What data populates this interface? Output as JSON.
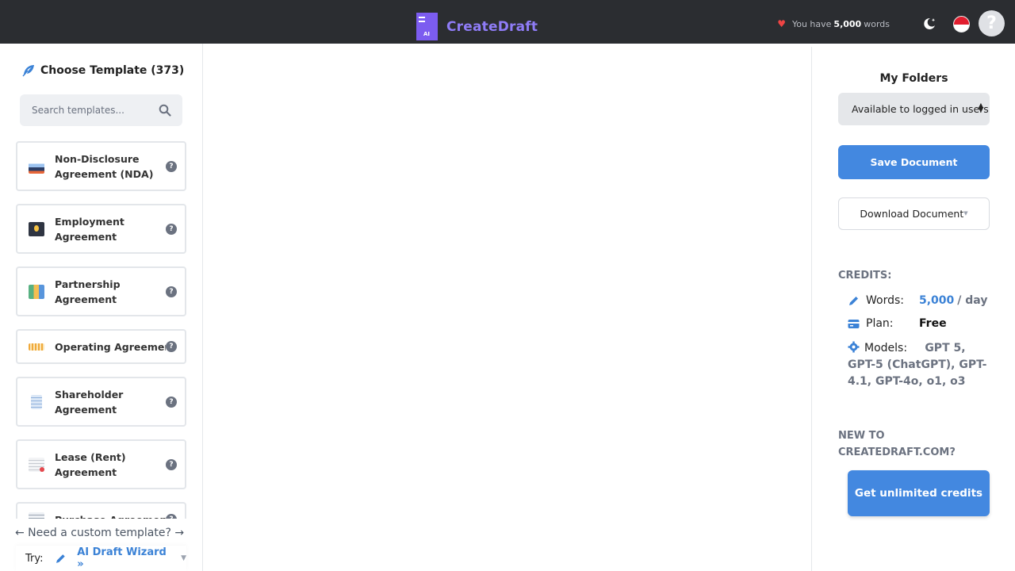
{
  "header": {
    "brand": "CreateDraft",
    "logo_badge": "AI",
    "words_prefix": "You have",
    "words_count": "5,000",
    "words_suffix": "words",
    "theme_toggle_icon": "moon-icon",
    "flag_icon": "singapore-flag-icon",
    "help_avatar": "?"
  },
  "sidebar": {
    "title": "Choose Template (373)",
    "search_placeholder": "Search templates...",
    "templates": [
      {
        "label": "Non-Disclosure Agreement (NDA)",
        "icon": "nda-icon"
      },
      {
        "label": "Employment Agreement",
        "icon": "employment-icon"
      },
      {
        "label": "Partnership Agreement",
        "icon": "partnership-icon"
      },
      {
        "label": "Operating Agreement",
        "icon": "operating-icon"
      },
      {
        "label": "Shareholder Agreement",
        "icon": "shareholder-icon"
      },
      {
        "label": "Lease (Rent) Agreement",
        "icon": "lease-icon"
      },
      {
        "label": "Purchase Agreement",
        "icon": "purchase-icon"
      }
    ],
    "help_glyph": "?",
    "custom_template": "← Need a custom template? →",
    "try_label": "Try:",
    "wizard_label": "AI Draft Wizard »"
  },
  "right": {
    "folders_title": "My Folders",
    "folder_select_value": "Available to logged in users",
    "save_button": "Save Document",
    "download_button": "Download Document",
    "credits_heading": "CREDITS:",
    "words_label": "Words:",
    "words_value": "5,000",
    "words_unit": "/ day",
    "plan_label": "Plan:",
    "plan_value": "Free",
    "models_label": "Models:",
    "models_value": "GPT 5, GPT-5 (ChatGPT), GPT-4.1, GPT-4o, o1, o3",
    "new_to": "NEW TO CREATEDRAFT.COM?",
    "unlimited_button": "Get unlimited credits"
  },
  "colors": {
    "accent_blue": "#4388e0",
    "brand_purple": "#7c5cf0",
    "topbar": "#2b2d31"
  }
}
